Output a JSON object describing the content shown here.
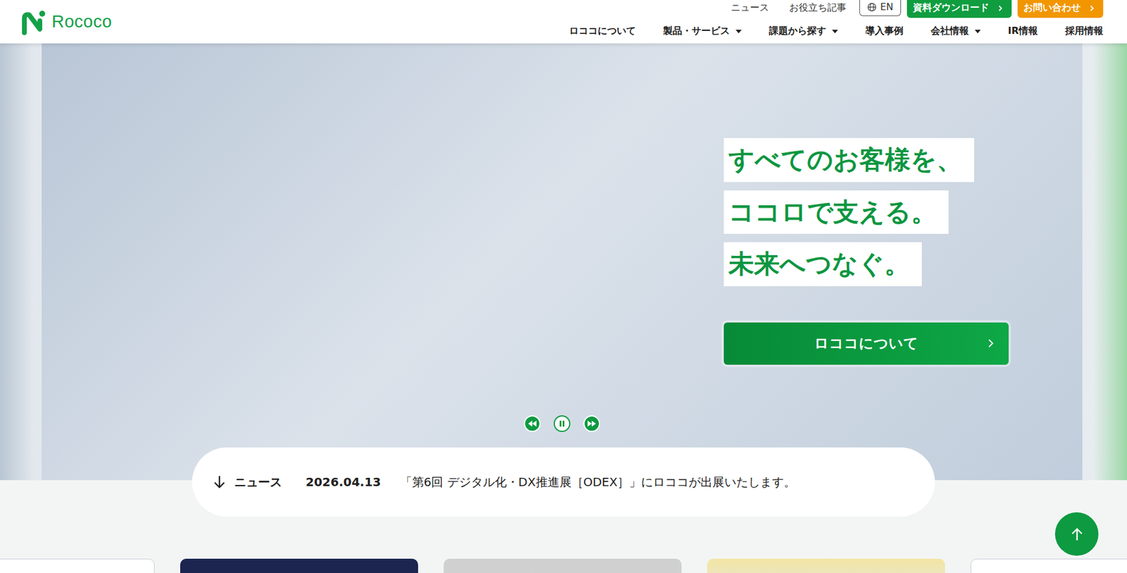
{
  "header": {
    "logo": "Rococo",
    "utility_links": [
      "ニュース",
      "お役立ち記事"
    ],
    "language": "EN",
    "buttons": [
      {
        "label": "資料ダウンロード",
        "kind": "download"
      },
      {
        "label": "お問い合わせ",
        "kind": "contact"
      }
    ]
  },
  "nav": [
    {
      "label": "ロココについて",
      "dropdown": false
    },
    {
      "label": "製品・サービス",
      "dropdown": true
    },
    {
      "label": "課題から探す",
      "dropdown": true
    },
    {
      "label": "導入事例",
      "dropdown": false
    },
    {
      "label": "会社情報",
      "dropdown": true
    },
    {
      "label": "IR情報",
      "dropdown": false
    },
    {
      "label": "採用情報",
      "dropdown": false
    }
  ],
  "hero": {
    "headline": [
      "すべてのお客様を、",
      "ココロで支える。",
      "未来へつなぐ。"
    ],
    "cta": "ロココについて",
    "carousel": {
      "playing": true
    }
  },
  "news": {
    "label": "ニュース",
    "date": "2026.04.13",
    "title": "「第6回 デジタル化・DX推進展［ODEX］」にロココが出展いたします。"
  },
  "cards": [
    {
      "kind": "light"
    },
    {
      "kind": "dark"
    },
    {
      "kind": "photo"
    },
    {
      "kind": "chart"
    },
    {
      "kind": "light"
    }
  ]
}
